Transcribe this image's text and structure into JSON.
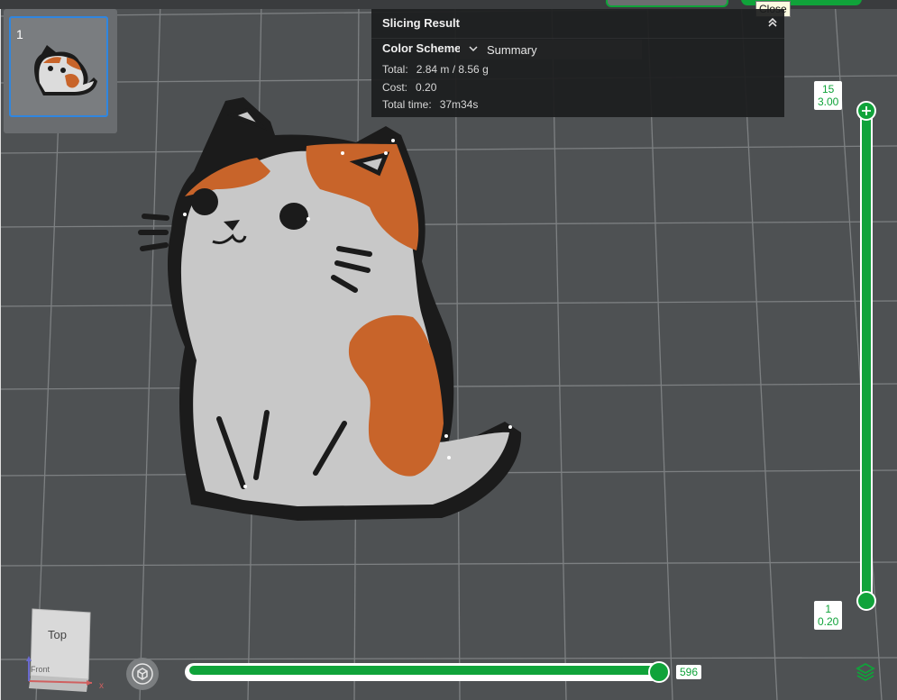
{
  "tooltip": {
    "text": "Close"
  },
  "plate": {
    "number": "1"
  },
  "slicing_result": {
    "title": "Slicing Result",
    "color_scheme_label": "Color Scheme",
    "color_scheme_value": "Summary",
    "total_label": "Total:",
    "total_value": "2.84 m / 8.56 g",
    "cost_label": "Cost:",
    "cost_value": "0.20",
    "time_label": "Total time:",
    "time_value": "37m34s"
  },
  "layer_slider": {
    "top_layer": "15",
    "top_height": "3.00",
    "bottom_layer": "1",
    "bottom_height": "0.20"
  },
  "move_slider": {
    "value": "596",
    "fraction": 0.97
  },
  "view_cube": {
    "face_label": "Top",
    "front_label": "Front",
    "axis_x": "x"
  },
  "colors": {
    "accent": "#10a33a",
    "bed": "#4e5153",
    "cat_gray": "#c8c8c8",
    "cat_orange": "#c8642a",
    "outline": "#1b1b1b"
  },
  "icons": [
    "collapse-icon",
    "chevron-down-icon",
    "orbit-icon",
    "layers-icon"
  ]
}
